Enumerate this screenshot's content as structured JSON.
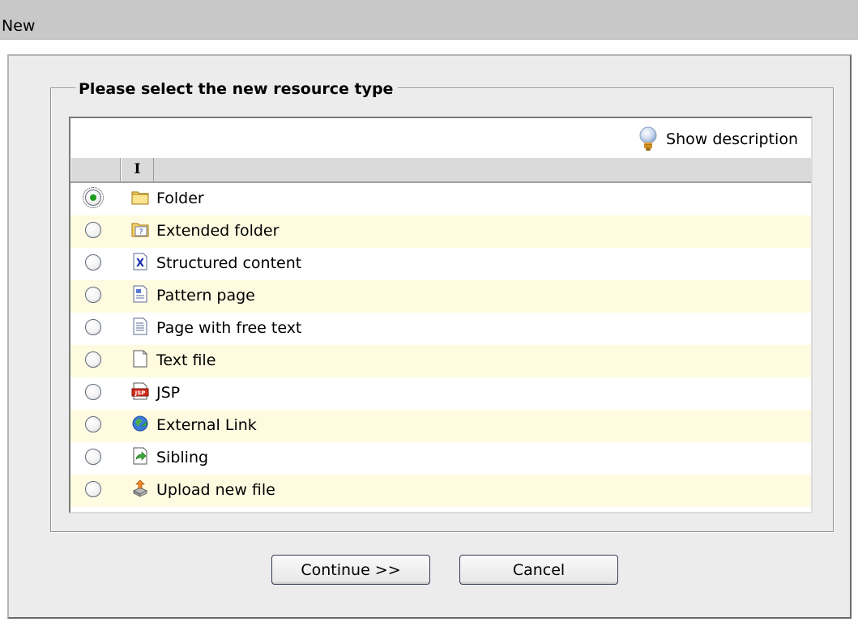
{
  "window": {
    "title": "New"
  },
  "fieldset": {
    "legend": "Please select the new resource type"
  },
  "toolbar": {
    "show_description": "Show description"
  },
  "table": {
    "header_icon_col": "I"
  },
  "resource_types": [
    {
      "label": "Folder",
      "icon": "folder-icon",
      "selected": true
    },
    {
      "label": "Extended folder",
      "icon": "extended-folder-icon",
      "selected": false
    },
    {
      "label": "Structured content",
      "icon": "structured-content-icon",
      "selected": false
    },
    {
      "label": "Pattern page",
      "icon": "pattern-page-icon",
      "selected": false
    },
    {
      "label": "Page with free text",
      "icon": "free-text-page-icon",
      "selected": false
    },
    {
      "label": "Text file",
      "icon": "text-file-icon",
      "selected": false
    },
    {
      "label": "JSP",
      "icon": "jsp-icon",
      "selected": false
    },
    {
      "label": "External Link",
      "icon": "external-link-icon",
      "selected": false
    },
    {
      "label": "Sibling",
      "icon": "sibling-icon",
      "selected": false
    },
    {
      "label": "Upload new file",
      "icon": "upload-icon",
      "selected": false
    }
  ],
  "buttons": {
    "continue_label": "Continue >>",
    "cancel_label": "Cancel"
  },
  "colors": {
    "title_bar": "#c8c8c8",
    "dialog_bg": "#ececec",
    "alt_row": "#fffbe0",
    "radio_dot": "#1c9c1c"
  }
}
